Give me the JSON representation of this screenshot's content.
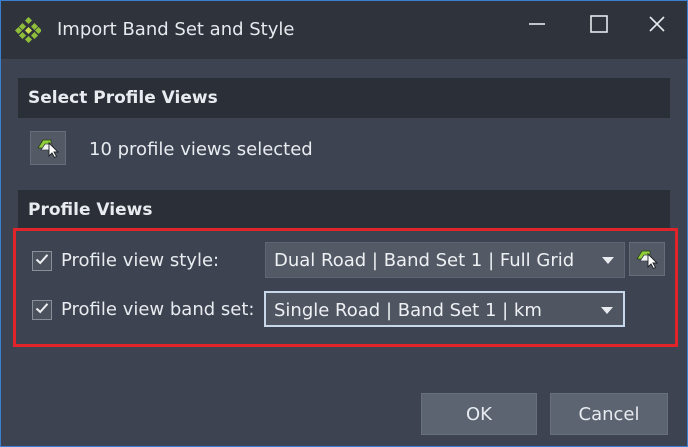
{
  "window": {
    "title": "Import Band Set and Style",
    "icon": "civil3d-diamond-icon",
    "controls": [
      "minimize-icon",
      "maximize-icon",
      "close-icon"
    ]
  },
  "select_section": {
    "header": "Select Profile Views",
    "pick_icon": "pick-object-icon",
    "status_text": "10 profile views selected"
  },
  "profile_views_section": {
    "header": "Profile Views",
    "style_row": {
      "checked": true,
      "label": "Profile view style:",
      "value": "Dual Road | Band Set 1 | Full Grid",
      "pick_icon": "pick-object-icon"
    },
    "band_set_row": {
      "checked": true,
      "label": "Profile view band set:",
      "value": "Single Road | Band Set 1 | km"
    }
  },
  "footer": {
    "ok_label": "OK",
    "cancel_label": "Cancel"
  },
  "colors": {
    "background": "#3d4350",
    "title_bar": "#2e333c",
    "section_header": "#2b2f37",
    "highlight_border": "#e0242a",
    "window_border": "#3a7fd0"
  }
}
